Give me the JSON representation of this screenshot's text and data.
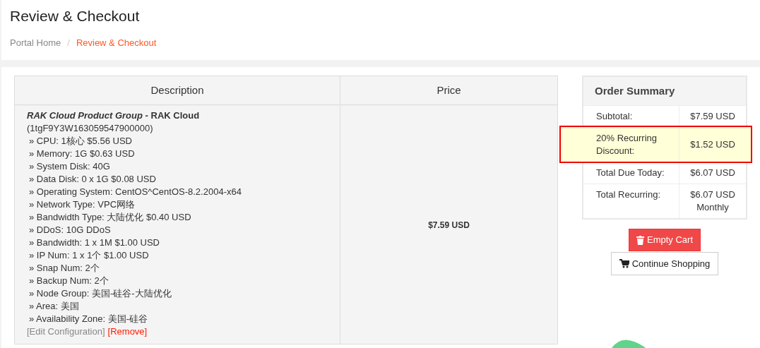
{
  "page_title": "Review & Checkout",
  "breadcrumb": [
    {
      "label": "Portal Home",
      "selected": false
    },
    {
      "label": "Review & Checkout",
      "selected": true
    }
  ],
  "breadcrumb_separator": "/",
  "cart": {
    "columns": [
      "Description",
      "Price"
    ],
    "items": [
      {
        "title": "*RAK Cloud Product Group* - RAK Cloud",
        "id": "(1tgF9Y3W163059547900000)",
        "options": [
          "» CPU: 1核心 $5.56 USD",
          "» Memory: 1G $0.63 USD",
          "» System Disk: 40G",
          "» Data Disk: 0 x 1G $0.08 USD",
          "» Operating System: CentOS^CentOS-8.2.2004-x64",
          "» Network Type: VPC网络",
          "» Bandwidth Type: 大陆优化 $0.40 USD",
          "» DDoS: 10G DDoS",
          "» Bandwidth: 1 x 1M $1.00 USD",
          "» IP Num: 1 x 1个 $1.00 USD",
          "» Snap Num: 2个",
          "» Backup Num: 2个",
          "» Node Group: 美国-硅谷-大陆优化",
          "» Area: 美国",
          "» Availability Zone: 美国-硅谷"
        ],
        "edit_link": "[Edit Configuration]",
        "remove_link": "[Remove]",
        "price": "$7.59 USD"
      }
    ]
  },
  "order_summary": {
    "title": "Order Summary",
    "rows": [
      {
        "label": "Subtotal:",
        "value": "$7.59 USD",
        "highlighted": false
      },
      {
        "label": "20% Recurring Discount:",
        "value": "$1.52 USD",
        "highlighted": true
      },
      {
        "label": "Total Due Today:",
        "value": "$6.07 USD",
        "highlighted": false
      },
      {
        "label": "Total Recurring:",
        "value": "$6.07 USD",
        "value_note": "Monthly",
        "highlighted": false
      }
    ]
  },
  "buttons": [
    {
      "kind": "danger",
      "label": "Empty Cart"
    },
    {
      "kind": "default",
      "label": "Continue Shopping"
    }
  ]
}
